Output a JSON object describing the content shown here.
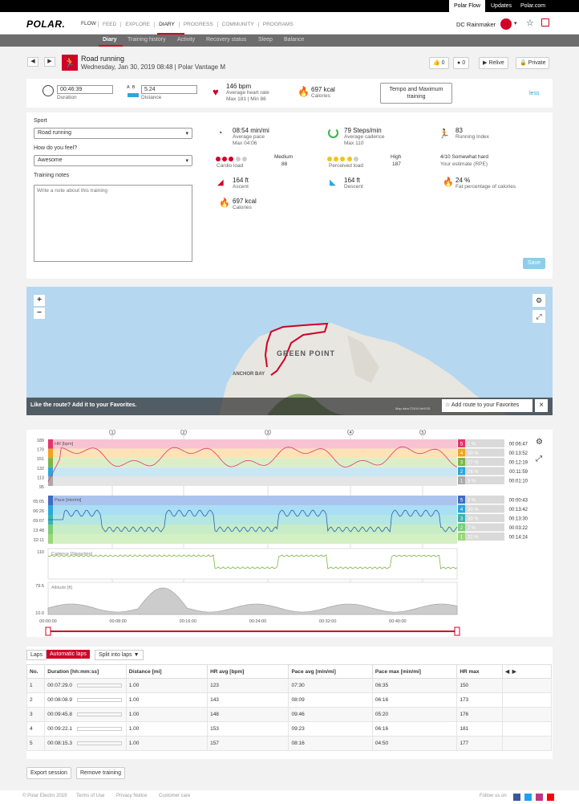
{
  "topbar": {
    "links": [
      "Polar Flow",
      "Updates",
      "Polar.com"
    ]
  },
  "header": {
    "logo": "POLAR.",
    "flow": "FLOW",
    "nav": [
      "FEED",
      "EXPLORE",
      "DIARY",
      "PROGRESS",
      "COMMUNITY",
      "PROGRAMS"
    ],
    "user": "DC Rainmaker"
  },
  "subnav": [
    "Diary",
    "Training history",
    "Activity",
    "Recovery status",
    "Sleep",
    "Balance"
  ],
  "session": {
    "title": "Road running",
    "subtitle": "Wednesday, Jan 30, 2019 08:48 | Polar Vantage M",
    "likes": "0",
    "comments": "0",
    "relive": "Relive",
    "private": "Private"
  },
  "summary": {
    "duration_value": "00:46:39",
    "duration_label": "Duration",
    "distance_value": "5.24",
    "distance_label": "Distance",
    "hr_value": "146 bpm",
    "hr_label": "Average heart rate",
    "hr_minmax": "Max 181  |  Min 86",
    "cal_value": "697 kcal",
    "cal_label": "Calories",
    "target_button": "Tempo and Maximum training",
    "less": "less"
  },
  "form": {
    "sport_label": "Sport",
    "sport_value": "Road running",
    "feel_label": "How do you feel?",
    "feel_value": "Awesome",
    "notes_label": "Training notes",
    "notes_placeholder": "Write a note about this training",
    "save": "Save"
  },
  "metrics": {
    "pace_value": "08:54 min/mi",
    "pace_label": "Average pace",
    "pace_max": "Max 04:06",
    "cadence_value": "79 Steps/min",
    "cadence_label": "Average cadence",
    "cadence_max": "Max 110",
    "ri_value": "83",
    "ri_label": "Running Index",
    "cardio_label": "Cardio load",
    "cardio_level": "Medium",
    "cardio_value": "88",
    "perceived_label": "Perceived load",
    "perceived_level": "High",
    "perceived_value": "187",
    "rpe_value": "4/10 Somewhat hard",
    "rpe_label": "Your estimate (RPE)",
    "ascent_value": "164 ft",
    "ascent_label": "Ascent",
    "descent_value": "164 ft",
    "descent_label": "Descent",
    "fat_value": "24 %",
    "fat_label": "Fat percentage of calories",
    "cal2_value": "697 kcal",
    "cal2_label": "Calories"
  },
  "map": {
    "zoom_in": "+",
    "zoom_out": "−",
    "area_label": "GREEN POINT",
    "bay_label": "ANCHOR BAY",
    "favorite_prompt": "Like the route?  Add it to your Favorites.",
    "favorite_button": "Add route to your Favorites",
    "close": "×",
    "attribution": "Map data ©2019 AfriGIS"
  },
  "chart": {
    "lap_markers": [
      "1",
      "2",
      "3",
      "4",
      "5"
    ],
    "hr_title": "HR [bpm]",
    "hr_ticks": [
      "189",
      "170",
      "151",
      "132",
      "113",
      "95"
    ],
    "pace_title": "Pace [min/mi]",
    "pace_ticks": [
      "05:05",
      "06:26",
      "09:07",
      "13:48",
      "32:11"
    ],
    "cadence_title": "Cadence [Steps/min]",
    "cadence_ticks": [
      "110",
      "0"
    ],
    "alt_title": "Altitude [ft]",
    "alt_ticks": [
      "79.5",
      "10.0"
    ],
    "time_ticks": [
      "00:00:00",
      "00:08:00",
      "00:16:00",
      "00:24:00",
      "00:32:00",
      "00:40:00"
    ],
    "hr_zones": [
      {
        "zone": "5",
        "pct": "1 %",
        "time": "00:06:47",
        "color": "#e5336e"
      },
      {
        "zone": "4",
        "pct": "30 %",
        "time": "00:13:52",
        "color": "#f4a11c"
      },
      {
        "zone": "3",
        "pct": "27 %",
        "time": "00:12:19",
        "color": "#7ab648"
      },
      {
        "zone": "2",
        "pct": "26 %",
        "time": "00:11:59",
        "color": "#2aa7dd"
      },
      {
        "zone": "1",
        "pct": "3 %",
        "time": "00:01:10",
        "color": "#aaaaaa"
      }
    ],
    "pace_zones": [
      {
        "zone": "5",
        "pct": "3 %",
        "time": "00:00:43",
        "color": "#3f6cc4"
      },
      {
        "zone": "4",
        "pct": "30 %",
        "time": "00:13:42",
        "color": "#2aa7dd"
      },
      {
        "zone": "3",
        "pct": "30 %",
        "time": "00:13:30",
        "color": "#38b6b0"
      },
      {
        "zone": "2",
        "pct": "7 %",
        "time": "00:03:22",
        "color": "#7ccc7a"
      },
      {
        "zone": "1",
        "pct": "32 %",
        "time": "00:14:24",
        "color": "#9ad77a"
      }
    ]
  },
  "laps": {
    "tabs": [
      "Laps",
      "Automatic laps",
      "Split into laps"
    ],
    "columns": [
      "No.",
      "Duration [hh:mm:ss]",
      "Distance [mi]",
      "HR avg [bpm]",
      "Pace avg [min/mi]",
      "Pace max [min/mi]",
      "HR max"
    ],
    "rows": [
      [
        "1",
        "00:07:29.0",
        "1.00",
        "123",
        "07:30",
        "06:35",
        "150"
      ],
      [
        "2",
        "00:08:08.9",
        "1.00",
        "143",
        "08:09",
        "06:16",
        "173"
      ],
      [
        "3",
        "00:09:45.8",
        "1.00",
        "148",
        "09:46",
        "05:20",
        "176"
      ],
      [
        "4",
        "00:09:22.1",
        "1.00",
        "153",
        "09:23",
        "06:16",
        "181"
      ],
      [
        "5",
        "00:08:15.3",
        "1.00",
        "157",
        "08:16",
        "04:50",
        "177"
      ]
    ]
  },
  "actions": {
    "export": "Export session",
    "remove": "Remove training"
  },
  "footer": {
    "links": [
      "© Polar Electro 2019",
      "Terms of Use",
      "Privacy Notice",
      "Customer care"
    ],
    "follow": "Follow us on"
  }
}
